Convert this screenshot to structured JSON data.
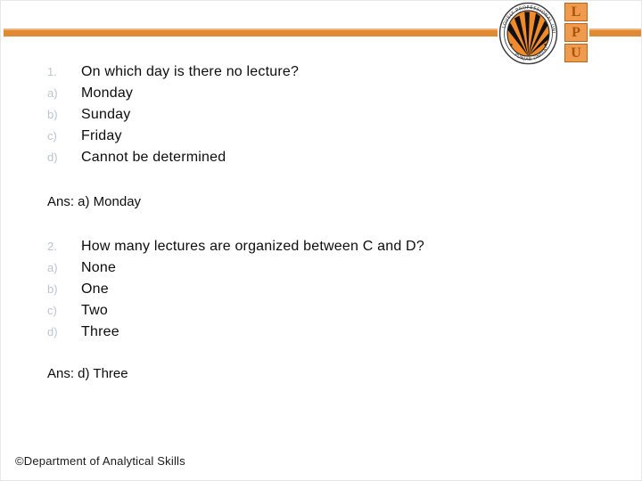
{
  "colors": {
    "bar_orange": "#e08b33",
    "bar_highlight": "#f0b277",
    "logo_orange": "#ef9a4d",
    "marker_gray": "#b9c5cf",
    "text_black": "#0d0d0d"
  },
  "logo": {
    "seal_icon": "lpu-seal-icon",
    "seal_outer_text_top": "LOVELY PROFESSIONAL UNIVERSITY",
    "seal_outer_text_bottom": "PUNJAB (INDIA)",
    "letters": [
      "L",
      "P",
      "U"
    ]
  },
  "questions": [
    {
      "marker": "1.",
      "text": "On which day is there no lecture?",
      "options": [
        {
          "marker": "a)",
          "text": "Monday"
        },
        {
          "marker": "b)",
          "text": "Sunday"
        },
        {
          "marker": "c)",
          "text": "Friday"
        },
        {
          "marker": "d)",
          "text": "Cannot be determined"
        }
      ],
      "answer": "Ans: a) Monday"
    },
    {
      "marker": "2.",
      "text": "How many lectures are organized between C and D?",
      "options": [
        {
          "marker": "a)",
          "text": "None"
        },
        {
          "marker": "b)",
          "text": "One"
        },
        {
          "marker": "c)",
          "text": "Two"
        },
        {
          "marker": "d)",
          "text": "Three"
        }
      ],
      "answer": "Ans: d) Three"
    }
  ],
  "footer": {
    "text": "©Department of Analytical Skills"
  }
}
